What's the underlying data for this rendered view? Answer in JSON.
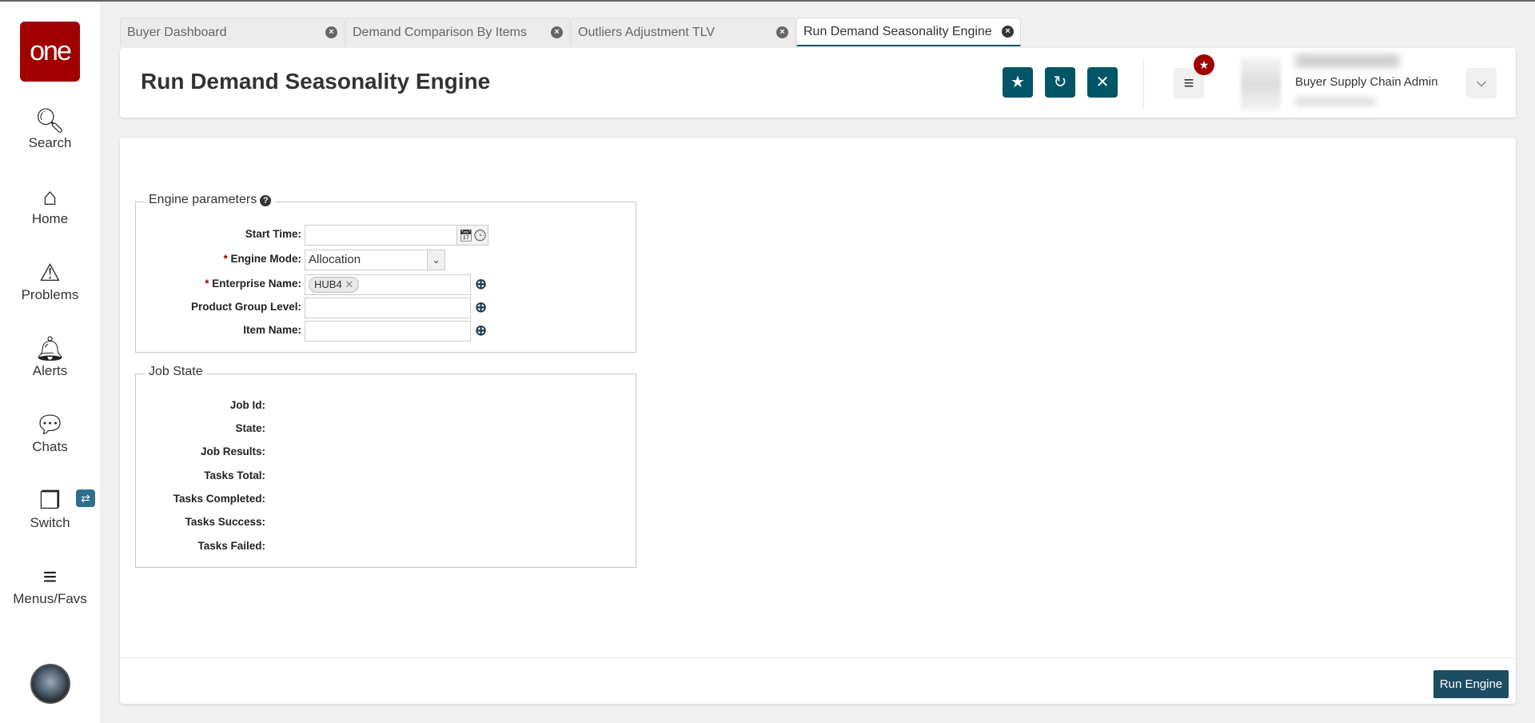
{
  "sidebar": {
    "logo": "one",
    "items": [
      {
        "label": "Search",
        "icon": "search-icon"
      },
      {
        "label": "Home",
        "icon": "home-icon"
      },
      {
        "label": "Problems",
        "icon": "warning-icon"
      },
      {
        "label": "Alerts",
        "icon": "bell-icon"
      },
      {
        "label": "Chats",
        "icon": "chat-icon"
      },
      {
        "label": "Switch",
        "icon": "switch-icon"
      },
      {
        "label": "Menus/Favs",
        "icon": "menu-icon"
      }
    ]
  },
  "tabs": [
    {
      "label": "Buyer Dashboard"
    },
    {
      "label": "Demand Comparison By Items"
    },
    {
      "label": "Outliers Adjustment TLV"
    },
    {
      "label": "Run Demand Seasonality Engine",
      "active": true
    }
  ],
  "header": {
    "title": "Run Demand Seasonality Engine",
    "user_role": "Buyer Supply Chain Admin"
  },
  "engine_parameters": {
    "legend": "Engine parameters",
    "fields": {
      "start_time": {
        "label": "Start Time:",
        "value": ""
      },
      "engine_mode": {
        "label": "Engine Mode:",
        "value": "Allocation"
      },
      "enterprise_name": {
        "label": "Enterprise Name:",
        "chip": "HUB4"
      },
      "product_group_level": {
        "label": "Product Group Level:",
        "value": ""
      },
      "item_name": {
        "label": "Item Name:",
        "value": ""
      }
    }
  },
  "job_state": {
    "legend": "Job State",
    "fields": [
      "Job Id:",
      "State:",
      "Job Results:",
      "Tasks Total:",
      "Tasks Completed:",
      "Tasks Success:",
      "Tasks Failed:"
    ]
  },
  "footer": {
    "run_label": "Run Engine"
  },
  "colors": {
    "brand": "#a00000",
    "accent": "#005566"
  }
}
